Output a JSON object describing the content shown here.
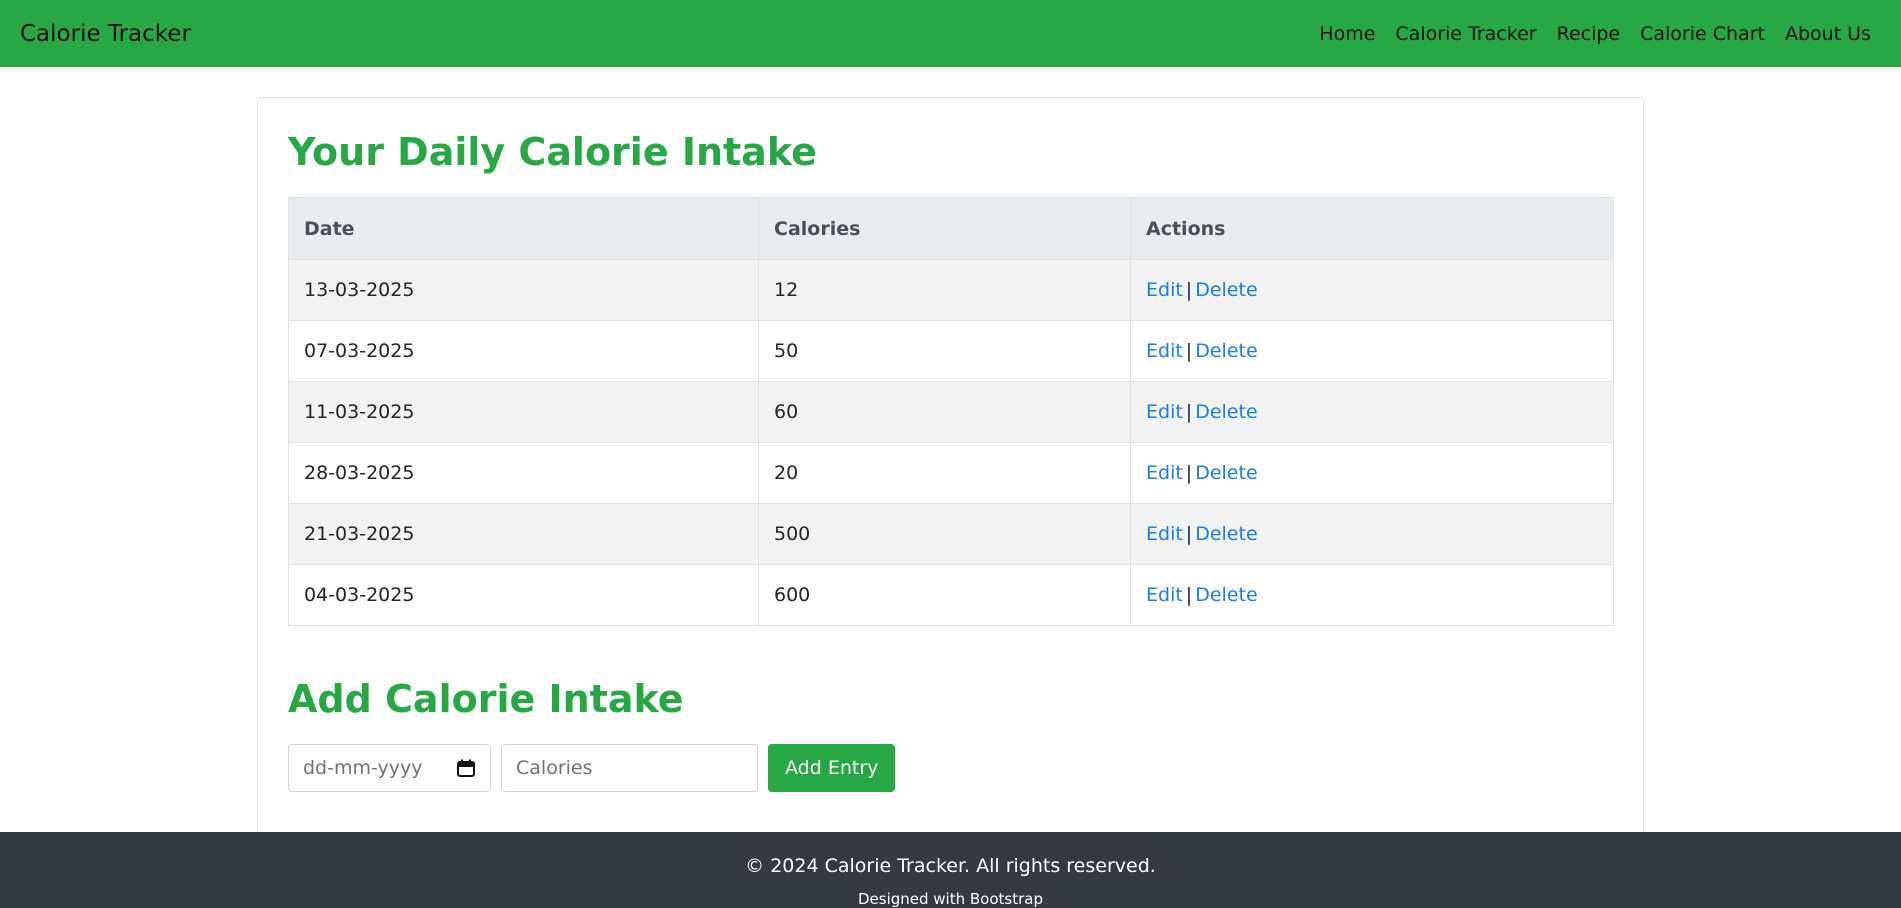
{
  "navbar": {
    "brand": "Calorie Tracker",
    "links": [
      "Home",
      "Calorie Tracker",
      "Recipe",
      "Calorie Chart",
      "About Us"
    ],
    "bg_color": "#28a745"
  },
  "intake_section": {
    "title": "Your Daily Calorie Intake",
    "table": {
      "headers": [
        "Date",
        "Calories",
        "Actions"
      ],
      "rows": [
        {
          "date": "13-03-2025",
          "calories": "12",
          "edit": "Edit",
          "sep": "|",
          "delete": "Delete"
        },
        {
          "date": "07-03-2025",
          "calories": "50",
          "edit": "Edit",
          "sep": "|",
          "delete": "Delete"
        },
        {
          "date": "11-03-2025",
          "calories": "60",
          "edit": "Edit",
          "sep": "|",
          "delete": "Delete"
        },
        {
          "date": "28-03-2025",
          "calories": "20",
          "edit": "Edit",
          "sep": "|",
          "delete": "Delete"
        },
        {
          "date": "21-03-2025",
          "calories": "500",
          "edit": "Edit",
          "sep": "|",
          "delete": "Delete"
        },
        {
          "date": "04-03-2025",
          "calories": "600",
          "edit": "Edit",
          "sep": "|",
          "delete": "Delete"
        }
      ]
    }
  },
  "add_section": {
    "title": "Add Calorie Intake",
    "date_placeholder": "dd-mm-yyyy",
    "date_icon": "calendar-icon",
    "calories_placeholder": "Calories",
    "button_label": "Add Entry"
  },
  "footer": {
    "copyright": "© 2024 Calorie Tracker. All rights reserved.",
    "designed": "Designed with Bootstrap",
    "bg_color": "#343a40"
  },
  "colors": {
    "accent": "#28a745",
    "link": "#1a7ee6"
  }
}
